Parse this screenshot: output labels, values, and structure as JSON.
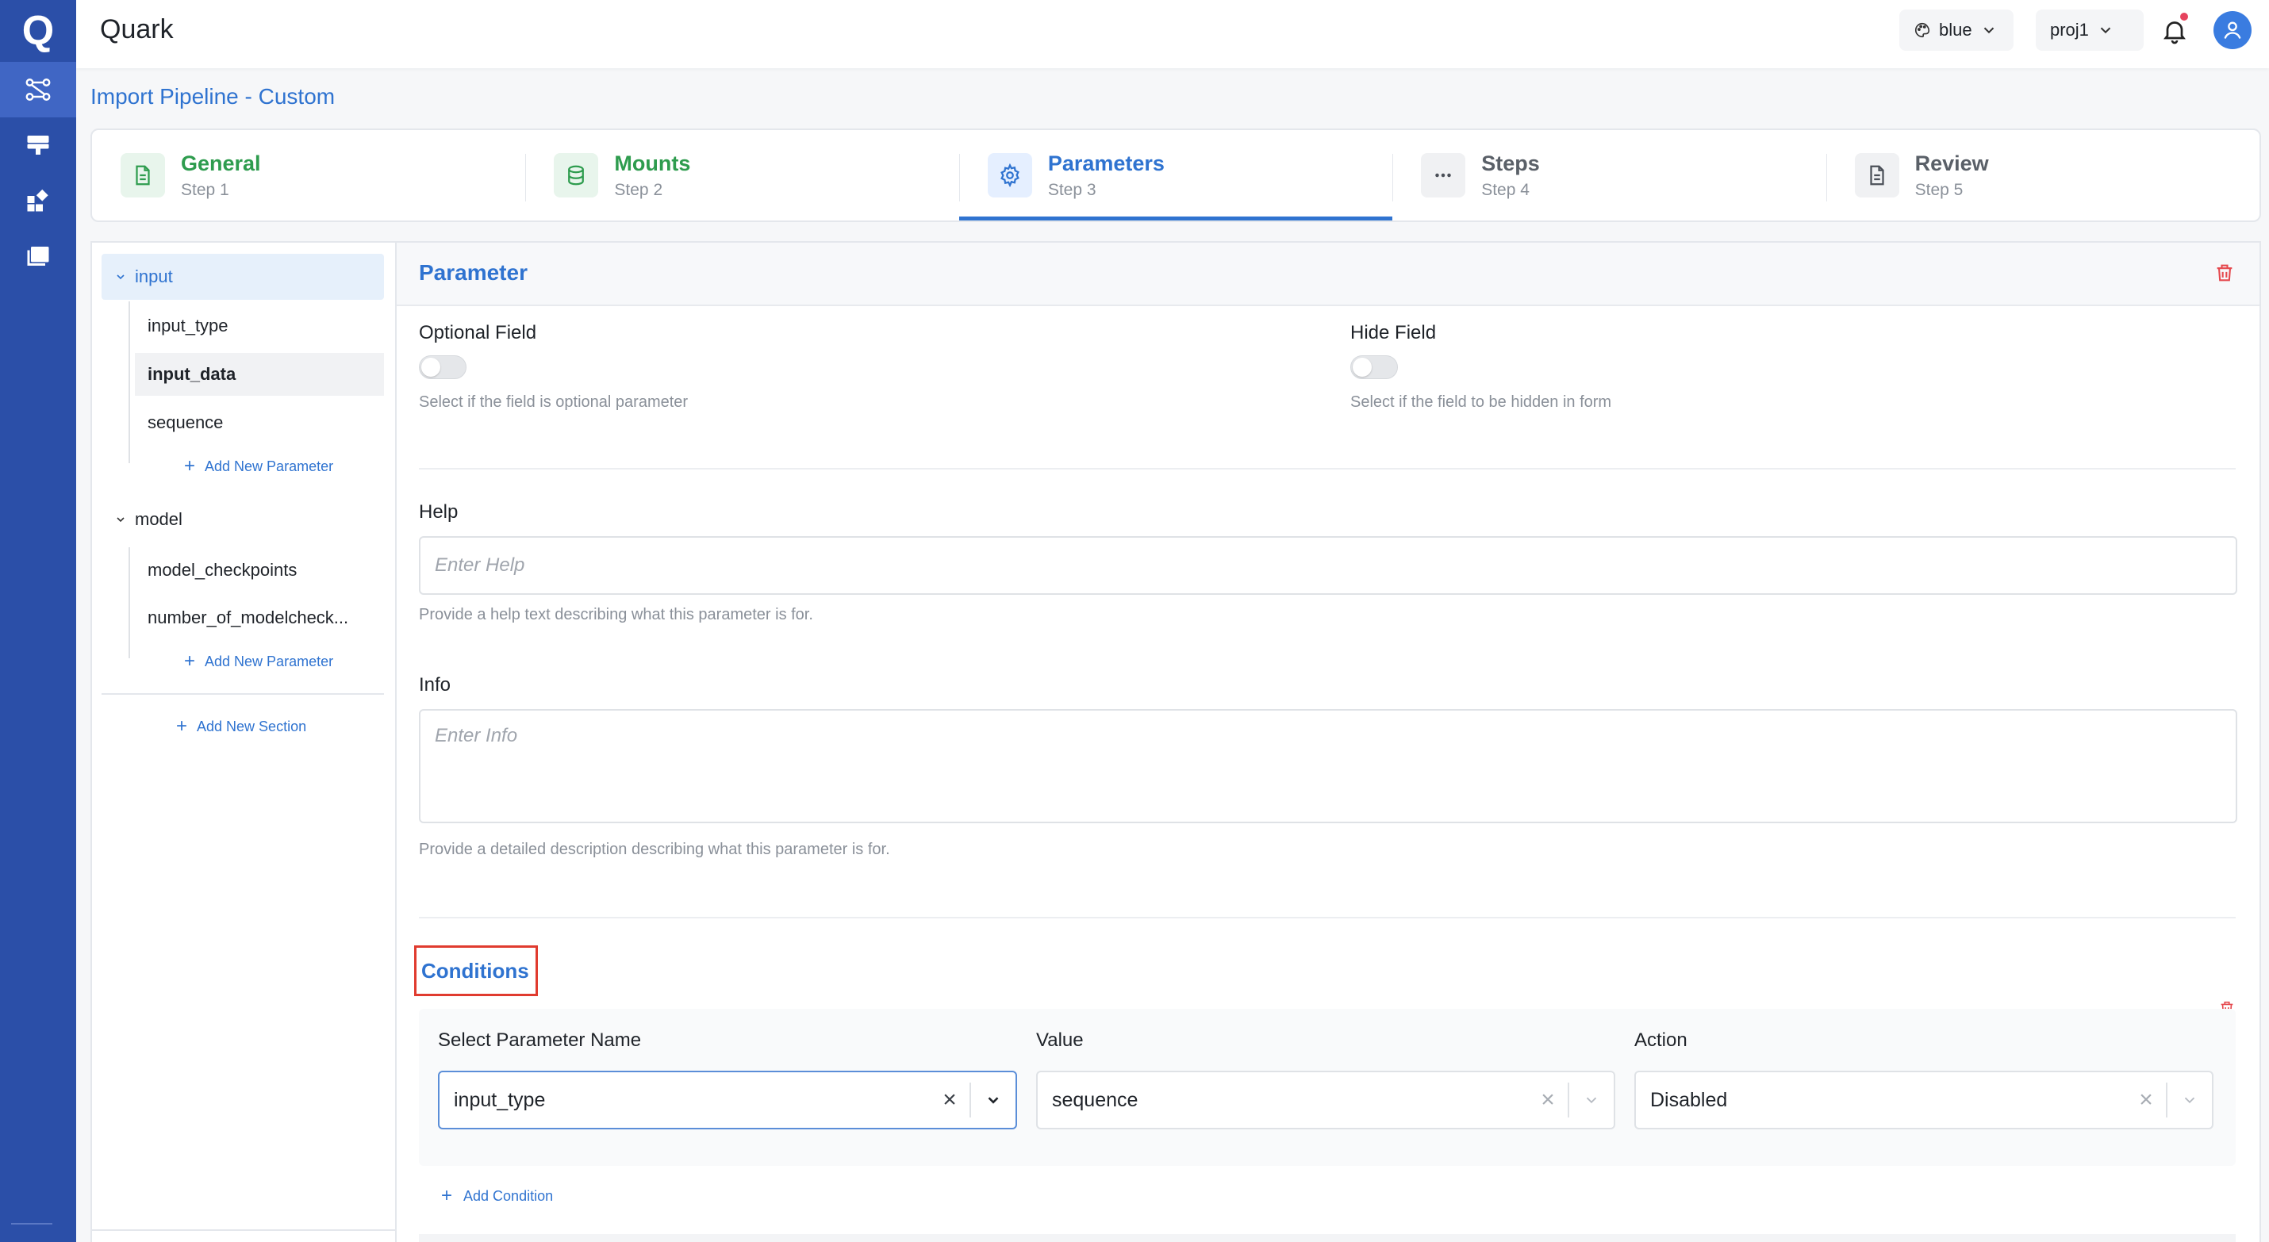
{
  "app": {
    "logo": "Q",
    "title": "Quark"
  },
  "header": {
    "theme_label": "blue",
    "project_label": "proj1"
  },
  "page_title": "Import Pipeline - Custom",
  "steps": [
    {
      "name": "General",
      "sub": "Step 1",
      "state": "done"
    },
    {
      "name": "Mounts",
      "sub": "Step 2",
      "state": "done"
    },
    {
      "name": "Parameters",
      "sub": "Step 3",
      "state": "active"
    },
    {
      "name": "Steps",
      "sub": "Step 4",
      "state": "todo"
    },
    {
      "name": "Review",
      "sub": "Step 5",
      "state": "todo"
    }
  ],
  "tree": {
    "sections": [
      {
        "name": "input",
        "items": [
          "input_type",
          "input_data",
          "sequence"
        ],
        "add_label": "Add New Parameter"
      },
      {
        "name": "model",
        "items": [
          "model_checkpoints",
          "number_of_modelcheck..."
        ],
        "add_label": "Add New Parameter"
      }
    ],
    "add_section_label": "Add New Section",
    "selected_item": "input_data"
  },
  "form": {
    "title": "Parameter",
    "optional": {
      "label": "Optional Field",
      "hint": "Select if the field is optional parameter"
    },
    "hide": {
      "label": "Hide Field",
      "hint": "Select if the field to be hidden in form"
    },
    "help": {
      "label": "Help",
      "placeholder": "Enter Help",
      "hint": "Provide a help text describing what this parameter is for."
    },
    "info": {
      "label": "Info",
      "placeholder": "Enter Info",
      "hint": "Provide a detailed description describing what this parameter is for."
    },
    "conditions": {
      "title": "Conditions",
      "param_label": "Select Parameter Name",
      "param_value": "input_type",
      "value_label": "Value",
      "value_value": "sequence",
      "action_label": "Action",
      "action_value": "Disabled",
      "add_label": "Add Condition"
    }
  },
  "colors": {
    "rail": "#2b4fa8",
    "accent": "#2f73d0",
    "done": "#2e9c4e",
    "highlight_box": "#e03b2f"
  }
}
